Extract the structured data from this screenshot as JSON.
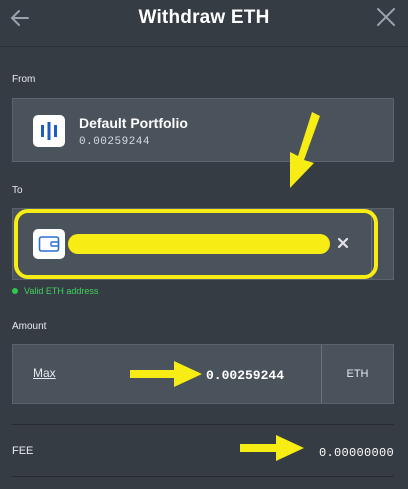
{
  "header": {
    "title": "Withdraw ETH",
    "back_icon": "arrow-left-icon",
    "close_icon": "close-icon"
  },
  "from": {
    "label": "From",
    "portfolio_name": "Default Portfolio",
    "portfolio_balance": "0.00259244",
    "icon": "portfolio-bars-icon"
  },
  "to": {
    "label": "To",
    "address_value": "",
    "wallet_icon": "wallet-icon",
    "clear_icon": "clear-icon",
    "validation": "Valid ETH address",
    "validation_color": "#2ec84a"
  },
  "amount": {
    "label": "Amount",
    "max_label": "Max",
    "value": "0.00259244",
    "currency": "ETH"
  },
  "fee": {
    "label": "FEE",
    "value": "0.00000000"
  },
  "colors": {
    "background": "#353c44",
    "panel": "#4a525b",
    "highlight": "#f7ec13"
  }
}
